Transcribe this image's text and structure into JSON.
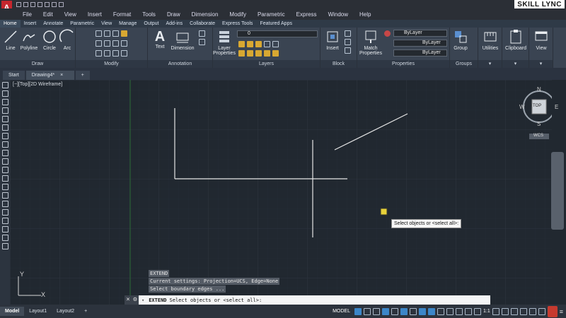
{
  "app": {
    "icon_letter": "A",
    "logo": "SKILL LYNC"
  },
  "menu": [
    "File",
    "Edit",
    "View",
    "Insert",
    "Format",
    "Tools",
    "Draw",
    "Dimension",
    "Modify",
    "Parametric",
    "Express",
    "Window",
    "Help"
  ],
  "ribbon_tabs": [
    "Home",
    "Insert",
    "Annotate",
    "Parametric",
    "View",
    "Manage",
    "Output",
    "Add-ins",
    "Collaborate",
    "Express Tools",
    "Featured Apps"
  ],
  "ribbon_tabs_active": "Home",
  "panels": {
    "draw": {
      "title": "Draw",
      "line": "Line",
      "polyline": "Polyline",
      "circle": "Circle",
      "arc": "Arc"
    },
    "modify": {
      "title": "Modify"
    },
    "annotation": {
      "title": "Annotation",
      "text": "Text",
      "dimension": "Dimension"
    },
    "layers": {
      "title": "Layers",
      "layer_properties": "Layer Properties",
      "layer_name": "0"
    },
    "block": {
      "title": "Block",
      "insert": "Insert"
    },
    "properties": {
      "title": "Properties",
      "match": "Match Properties",
      "bylayer1": "ByLayer",
      "bylayer2": "ByLayer",
      "bylayer3": "ByLayer"
    },
    "groups": {
      "title": "Groups",
      "group": "Group"
    },
    "utilities": {
      "label": "Utilities"
    },
    "clipboard": {
      "label": "Clipboard"
    },
    "view": {
      "label": "View"
    }
  },
  "doc_tabs": {
    "start": "Start",
    "drawing": "Drawing4*",
    "close": "×",
    "add": "+"
  },
  "viewport_label": "[−][Top][2D Wireframe]",
  "viewcube": {
    "n": "N",
    "s": "S",
    "e": "E",
    "w": "W",
    "top": "TOP",
    "wcs": "WCS"
  },
  "ucs": {
    "y": "Y",
    "x": "X"
  },
  "command_history": [
    "EXTEND",
    "Current settings: Projection=UCS, Edge=None",
    "Select boundary edges ..."
  ],
  "command_line": {
    "command": "EXTEND",
    "prompt": "Select objects or <select all>:"
  },
  "tooltip": "Select objects or <select all>:",
  "layout_tabs": [
    "Model",
    "Layout1",
    "Layout2"
  ],
  "layout_active": "Model",
  "status": {
    "model": "MODEL",
    "scale": "1:1"
  }
}
